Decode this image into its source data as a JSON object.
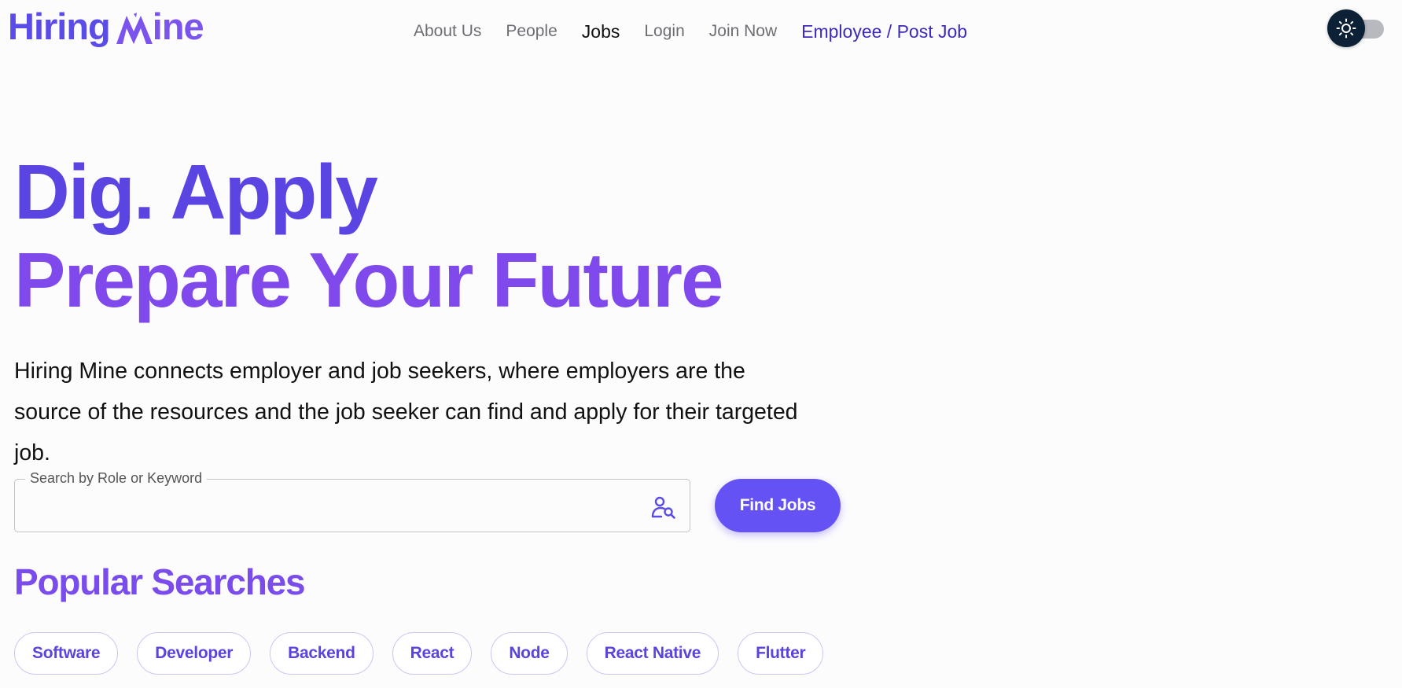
{
  "brand": {
    "name_part_1": "Hiring",
    "name_part_2": "ine",
    "logo_mark": "M",
    "primary_color": "#5b4be8",
    "accent_color": "#7b54ee"
  },
  "nav": {
    "items": [
      {
        "label": "About Us"
      },
      {
        "label": "People"
      },
      {
        "label": "Jobs",
        "active": true
      },
      {
        "label": "Login"
      },
      {
        "label": "Join Now"
      }
    ],
    "employer_link": "Employee / Post Job"
  },
  "theme_toggle": {
    "icon": "sun-icon",
    "mode": "light"
  },
  "hero": {
    "title_line_1": "Dig. Apply",
    "title_line_2": "Prepare Your Future",
    "description": "Hiring Mine connects employer and job seekers, where employers are the source of the resources and the job seeker can find and apply for their targeted job."
  },
  "search": {
    "label": "Search by Role or Keyword",
    "value": "",
    "placeholder": "",
    "icon": "user-search-icon",
    "button_label": "Find Jobs"
  },
  "popular": {
    "title": "Popular Searches",
    "chips": [
      {
        "label": "Software"
      },
      {
        "label": "Developer"
      },
      {
        "label": "Backend"
      },
      {
        "label": "React"
      },
      {
        "label": "Node"
      },
      {
        "label": "React Native"
      },
      {
        "label": "Flutter"
      }
    ]
  }
}
